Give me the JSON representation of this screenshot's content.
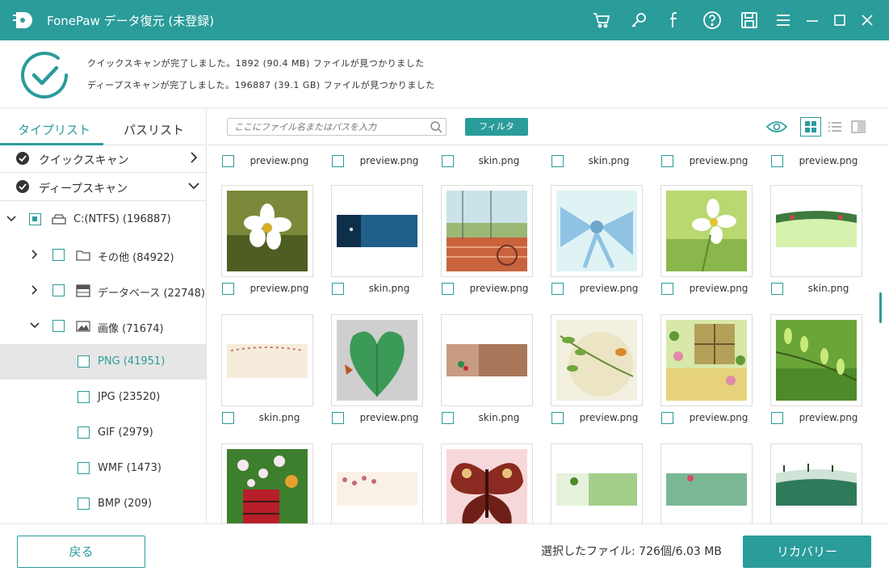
{
  "app": {
    "title": "FonePaw データ復元 (未登録)",
    "accent": "#2a9c9a"
  },
  "titlebar_icons": [
    "cart-icon",
    "key-icon",
    "facebook-icon",
    "help-icon",
    "save-icon",
    "menu-icon",
    "minimize-icon",
    "maximize-icon",
    "close-icon"
  ],
  "status": {
    "line1": "クイックスキャンが完了しました。1892 (90.4 MB) ファイルが見つかりました",
    "line2": "ディープスキャンが完了しました。196887 (39.1 GB) ファイルが見つかりました"
  },
  "sidebar": {
    "tabs": [
      "タイプリスト",
      "パスリスト"
    ],
    "active_tab": 0,
    "scans": [
      {
        "label": "クイックスキャン",
        "expanded": false
      },
      {
        "label": "ディープスキャン",
        "expanded": true
      }
    ],
    "tree": [
      {
        "label": "C:(NTFS) (196887)",
        "icon": "drive-icon",
        "expanded": true,
        "selected": false
      },
      {
        "label": "その他 (84922)",
        "icon": "folder-icon",
        "expanded": false,
        "selected": false
      },
      {
        "label": "データベース (22748)",
        "icon": "database-icon",
        "expanded": false,
        "selected": false
      },
      {
        "label": "画像 (71674)",
        "icon": "image-icon",
        "expanded": true,
        "selected": false
      },
      {
        "label": "PNG (41951)",
        "selected": true
      },
      {
        "label": "JPG (23520)",
        "selected": false
      },
      {
        "label": "GIF (2979)",
        "selected": false
      },
      {
        "label": "WMF (1473)",
        "selected": false
      },
      {
        "label": "BMP (209)",
        "selected": false
      }
    ]
  },
  "toolbar": {
    "search_placeholder": "ここにファイル名またはパスを入力",
    "filter_label": "フィルタ",
    "views": [
      "eye-icon",
      "grid-view-icon",
      "list-view-icon",
      "detail-view-icon"
    ],
    "active_view": "grid-view-icon"
  },
  "grid": {
    "rows": [
      [
        "preview.png",
        "preview.png",
        "skin.png",
        "skin.png",
        "preview.png",
        "preview.png"
      ],
      [
        "preview.png",
        "skin.png",
        "preview.png",
        "preview.png",
        "preview.png",
        "skin.png"
      ],
      [
        "skin.png",
        "preview.png",
        "skin.png",
        "preview.png",
        "preview.png",
        "preview.png"
      ],
      [
        "",
        "",
        "",
        "",
        "",
        ""
      ]
    ],
    "thumbs": [
      [
        "",
        "",
        "",
        "",
        "",
        ""
      ],
      [
        "white-flower",
        "blue-banner",
        "playground",
        "blue-bow",
        "white-cosmos",
        "green-banner"
      ],
      [
        "pink-flower-banner",
        "green-heart-leaf",
        "brown-banner",
        "bird-branch",
        "flower-window",
        "green-sprout"
      ],
      [
        "flower-vase",
        "pink-blossom-banner",
        "butterfly",
        "green-banner-2",
        "green-banner-3",
        "teal-banner"
      ]
    ]
  },
  "bottom": {
    "back_label": "戻る",
    "selected_info": "選択したファイル: 726個/6.03 MB",
    "recover_label": "リカバリー"
  }
}
